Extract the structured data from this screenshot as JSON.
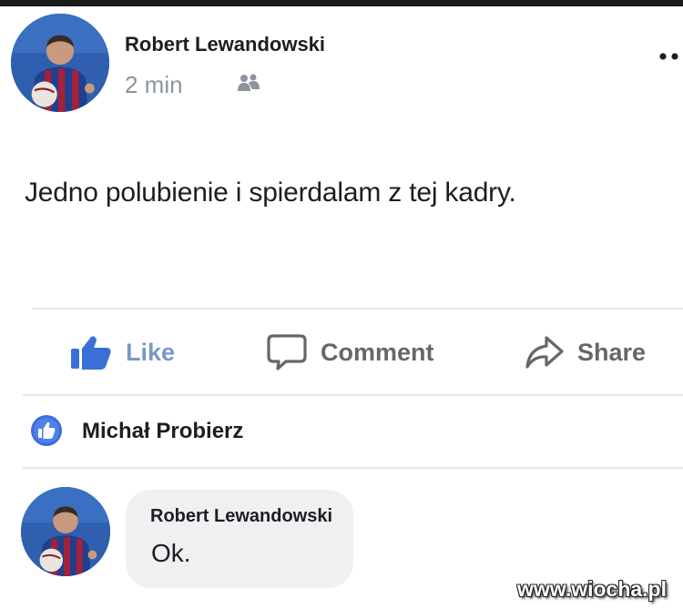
{
  "post": {
    "author": "Robert Lewandowski",
    "time": "2 min",
    "text": "Jedno polubienie i spierdalam z tej kadry.",
    "audience_icon": "friends-icon",
    "more_icon": "more-options-icon"
  },
  "actions": {
    "like": "Like",
    "comment": "Comment",
    "share": "Share"
  },
  "likes": {
    "badge_icon": "like-badge-icon",
    "liker": "Michał Probierz"
  },
  "comment": {
    "author": "Robert Lewandowski",
    "text": "Ok."
  },
  "watermark": "www.wiocha.pl",
  "colors": {
    "like_blue": "#3b6fd8",
    "muted_gray": "#65676b",
    "bubble_bg": "#eff0f2",
    "jersey_blue": "#1f3f8f",
    "jersey_red": "#a3213a"
  }
}
